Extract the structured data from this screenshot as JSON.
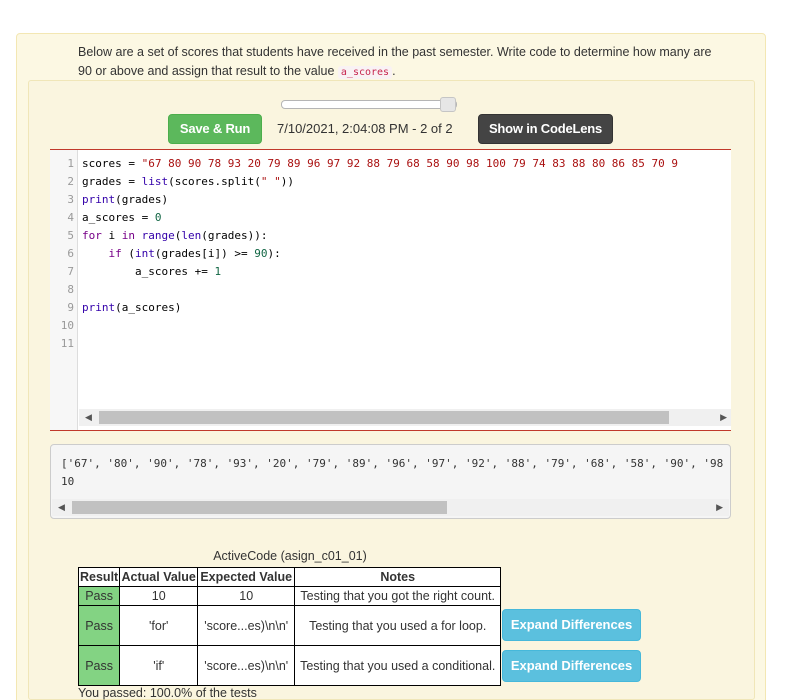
{
  "prompt": {
    "text": "Below are a set of scores that students have received in the past semester. Write code to determine how many are 90 or above and assign that result to the value",
    "code_term": "a_scores",
    "trailing": "."
  },
  "toolbar": {
    "run_label": "Save & Run",
    "timestamp": "7/10/2021, 2:04:08 PM - 2 of 2",
    "codelens_label": "Show in CodeLens",
    "history_position": 1.0
  },
  "editor": {
    "lines": [
      {
        "n": "1",
        "tokens": [
          [
            "",
            "scores = "
          ],
          [
            "str",
            "\"67 80 90 78 93 20 79 89 96 97 92 88 79 68 58 90 98 100 79 74 83 88 80 86 85 70 9"
          ]
        ]
      },
      {
        "n": "2",
        "tokens": [
          [
            "",
            "grades = "
          ],
          [
            "bi",
            "list"
          ],
          [
            "",
            "(scores.split("
          ],
          [
            "str",
            "\" \""
          ],
          [
            "",
            "))"
          ]
        ]
      },
      {
        "n": "3",
        "tokens": [
          [
            "bi",
            "print"
          ],
          [
            "",
            "(grades)"
          ]
        ]
      },
      {
        "n": "4",
        "tokens": [
          [
            "",
            "a_scores = "
          ],
          [
            "num",
            "0"
          ]
        ]
      },
      {
        "n": "5",
        "tokens": [
          [
            "kw",
            "for"
          ],
          [
            "",
            " i "
          ],
          [
            "kw",
            "in"
          ],
          [
            "",
            " "
          ],
          [
            "bi",
            "range"
          ],
          [
            "",
            "("
          ],
          [
            "bi",
            "len"
          ],
          [
            "",
            "(grades)):"
          ]
        ]
      },
      {
        "n": "6",
        "tokens": [
          [
            "",
            "    "
          ],
          [
            "kw",
            "if"
          ],
          [
            "",
            " ("
          ],
          [
            "bi",
            "int"
          ],
          [
            "",
            "(grades[i]) >= "
          ],
          [
            "num",
            "90"
          ],
          [
            "",
            "):"
          ]
        ]
      },
      {
        "n": "7",
        "tokens": [
          [
            "",
            "        a_scores += "
          ],
          [
            "num",
            "1"
          ]
        ]
      },
      {
        "n": "8",
        "tokens": []
      },
      {
        "n": "9",
        "tokens": [
          [
            "bi",
            "print"
          ],
          [
            "",
            "(a_scores)"
          ]
        ]
      },
      {
        "n": "10",
        "tokens": []
      },
      {
        "n": "11",
        "tokens": []
      }
    ]
  },
  "output": {
    "text": "['67', '80', '90', '78', '93', '20', '79', '89', '96', '97', '92', '88', '79', '68', '58', '90', '98\n10"
  },
  "results": {
    "caption": "ActiveCode (asign_c01_01)",
    "headers": [
      "Result",
      "Actual Value",
      "Expected Value",
      "Notes"
    ],
    "rows": [
      {
        "result": "Pass",
        "actual": "10",
        "expected": "10",
        "notes": "Testing that you got the right count."
      },
      {
        "result": "Pass",
        "actual": "'for'",
        "expected": "'score...es)\\n\\n'",
        "notes": "Testing that you used a for loop."
      },
      {
        "result": "Pass",
        "actual": "'if'",
        "expected": "'score...es)\\n\\n'",
        "notes": "Testing that you used a conditional."
      }
    ],
    "expand_label": "Expand Differences",
    "summary": "You passed: 100.0% of the tests"
  },
  "colors": {
    "run": "#5cb85c",
    "codelens": "#444444",
    "expand": "#5bc0de",
    "pass": "#83d383",
    "panel": "#fcf8e3"
  }
}
